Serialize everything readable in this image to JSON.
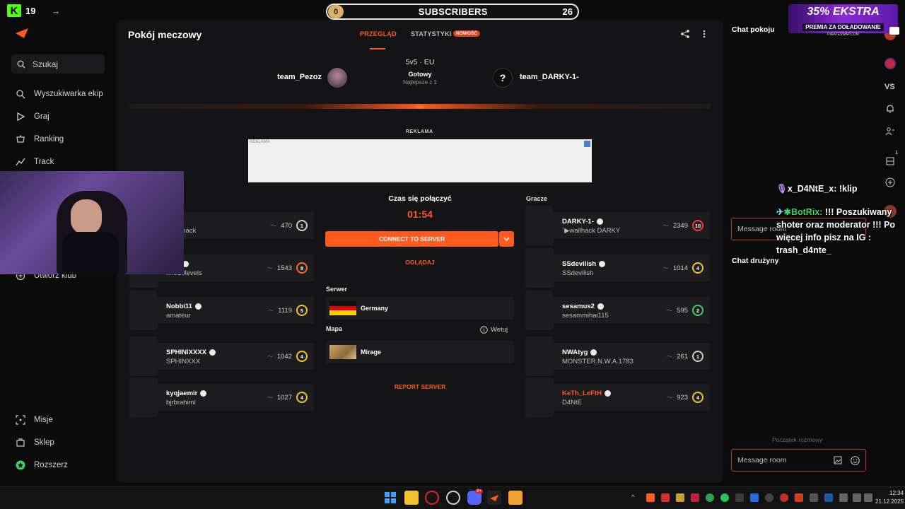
{
  "stream_overlay": {
    "kick_count": "19",
    "subs_dot": "0",
    "subs_label": "SUBSCRIBERS",
    "subs_count": "26",
    "promo_big": "35% EKSTRA",
    "promo_small": "PREMIA ZA DOŁADOWANIE",
    "promo_url": "PIRATESWAP.COM",
    "chat_lines": [
      {
        "user": "x_D4NtE_x:",
        "text": " !klip"
      },
      {
        "user": "BotRix:",
        "text": " !!! Poszukiwany shoter oraz moderator !!! Po więcej info pisz na IG : trash_d4nte_"
      }
    ]
  },
  "sidebar": {
    "search_label": "Szukaj",
    "items": [
      {
        "label": "Wyszukiwarka ekip",
        "icon": "team-search-icon"
      },
      {
        "label": "Graj",
        "icon": "play-icon"
      },
      {
        "label": "Ranking",
        "icon": "ranking-icon"
      },
      {
        "label": "Track",
        "icon": "track-icon"
      },
      {
        "label": "Utwórz klub",
        "icon": "plus-icon"
      }
    ],
    "bottom_items": [
      {
        "label": "Misje",
        "icon": "missions-icon"
      },
      {
        "label": "Sklep",
        "icon": "shop-icon"
      },
      {
        "label": "Rozszerz",
        "icon": "extend-icon"
      }
    ]
  },
  "room": {
    "title": "Pokój meczowy",
    "tabs": [
      {
        "label": "PRZEGLĄD"
      },
      {
        "label": "STATYSTYKI"
      }
    ],
    "new_badge": "NOWOŚĆ",
    "team_left": "team_Pezoz",
    "team_right": "team_DARKY-1-",
    "format": "5v5 · EU",
    "status": "Gotowy",
    "best_of": "Najlepsze z 1",
    "ad_label": "REKLAMA",
    "ad_inner": "REKLAMA",
    "connect_label": "Czas się połączyć",
    "timer": "01:54",
    "connect_button": "CONNECT TO SERVER",
    "watch_button": "OGLĄDAJ",
    "server_label": "Serwer",
    "server_value": "Germany",
    "map_label": "Mapa",
    "veto_label": "Wetuj",
    "map_value": "Mirage",
    "report_button": "REPORT SERVER",
    "players_label": "Gracze"
  },
  "team_left_players": [
    {
      "name": "z",
      "sub": "ery Snack",
      "elo": "470",
      "level": "1",
      "level_color": "#cfcfcf"
    },
    {
      "name": "H0R",
      "sub": "f...o10levels",
      "elo": "1543",
      "level": "8",
      "level_color": "#ff6a20"
    },
    {
      "name": "Nobbi11",
      "sub": "amateur",
      "elo": "1119",
      "level": "5",
      "level_color": "#f2c230"
    },
    {
      "name": "SPHINIXXXX",
      "sub": "SPHINXXX",
      "elo": "1042",
      "level": "4",
      "level_color": "#f2c230"
    },
    {
      "name": "kyqjaemir",
      "sub": "bjrbrahimi",
      "elo": "1027",
      "level": "4",
      "level_color": "#f2c230"
    }
  ],
  "team_right_players": [
    {
      "name": "DARKY-1-",
      "sub": "`▶wallhack DARKY",
      "elo": "2349",
      "level": "10",
      "level_color": "#ff3b2f",
      "name_color": "#ffffff"
    },
    {
      "name": "SSdevilish",
      "sub": "SSdevilish",
      "elo": "1014",
      "level": "4",
      "level_color": "#f2c230",
      "name_color": "#ffffff"
    },
    {
      "name": "sesamus2",
      "sub": "sesammihai115",
      "elo": "595",
      "level": "2",
      "level_color": "#3fd06a",
      "name_color": "#ffffff"
    },
    {
      "name": "NWAtyg",
      "sub": "MONSTER.N.W.A.1783",
      "elo": "261",
      "level": "1",
      "level_color": "#cfcfcf",
      "name_color": "#ffffff"
    },
    {
      "name": "KeTh_LeFtH",
      "sub": "D4NtE",
      "elo": "923",
      "level": "4",
      "level_color": "#f2c230",
      "name_color": "#ff5a1f"
    }
  ],
  "chat": {
    "room_title": "Chat pokoju",
    "team_title": "Chat drużyny",
    "placeholder": "Message room",
    "start_label": "Początek rozmowy"
  },
  "right_rail": {
    "vs_label": "VS",
    "badge_count": "1",
    "chat_count": "1"
  },
  "taskbar": {
    "time": "12:34",
    "date": "21.12.2025",
    "discord_badge": "9+"
  },
  "colors": {
    "accent": "#ff5a1f",
    "kick": "#53fc18"
  }
}
